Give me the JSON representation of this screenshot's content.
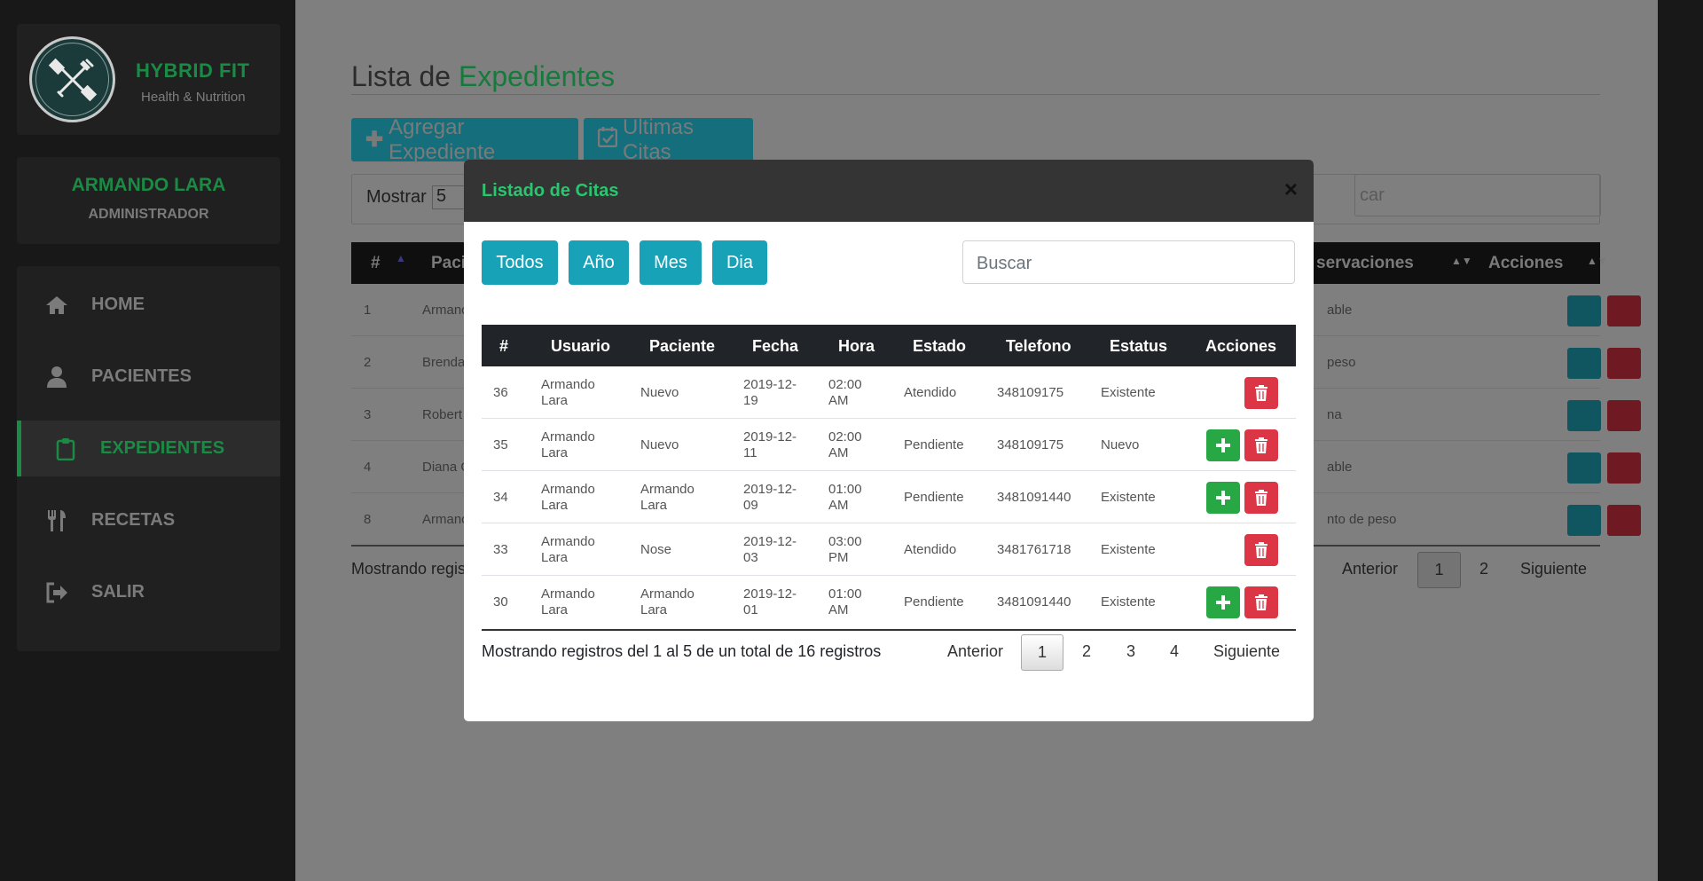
{
  "brand": {
    "name": "HYBRID FIT",
    "tagline": "Health & Nutrition",
    "logo_text": "HYBRID FIT"
  },
  "user": {
    "name": "ARMANDO LARA",
    "role": "ADMINISTRADOR"
  },
  "nav": [
    {
      "label": "HOME",
      "icon": "home-icon"
    },
    {
      "label": "PACIENTES",
      "icon": "user-icon"
    },
    {
      "label": "EXPEDIENTES",
      "icon": "clipboard-icon",
      "active": true
    },
    {
      "label": "RECETAS",
      "icon": "utensils-icon"
    },
    {
      "label": "SALIR",
      "icon": "sign-out-icon"
    }
  ],
  "page": {
    "title_prefix": "Lista de",
    "title_highlight": "Expedientes",
    "add_button": "Agregar Expediente",
    "citas_button": "Ultimas Citas",
    "show_label": "Mostrar",
    "show_value": "5",
    "search_partial": "car",
    "columns": {
      "num": "#",
      "paciente": "Paci",
      "observaciones": "servaciones",
      "acciones": "Acciones"
    },
    "rows": [
      {
        "num": "1",
        "name": "Armanc",
        "obs": "able"
      },
      {
        "num": "2",
        "name": "Brenda",
        "obs": "peso"
      },
      {
        "num": "3",
        "name": "Robert",
        "obs": "na"
      },
      {
        "num": "4",
        "name": "Diana G",
        "obs": "able"
      },
      {
        "num": "8",
        "name": "Armanc",
        "obs": "nto de peso"
      }
    ],
    "footer_partial": "Mostrando regis",
    "pager": {
      "prev": "Anterior",
      "pages": [
        "1",
        "2"
      ],
      "next": "Siguiente"
    }
  },
  "modal": {
    "title": "Listado de Citas",
    "close": "×",
    "filters": [
      "Todos",
      "Año",
      "Mes",
      "Dia"
    ],
    "search_placeholder": "Buscar",
    "columns": [
      "#",
      "Usuario",
      "Paciente",
      "Fecha",
      "Hora",
      "Estado",
      "Telefono",
      "Estatus",
      "Acciones"
    ],
    "rows": [
      {
        "num": "36",
        "usuario_l1": "Armando",
        "usuario_l2": "Lara",
        "paciente_l1": "Nuevo",
        "paciente_l2": "",
        "fecha_l1": "2019-12-",
        "fecha_l2": "19",
        "hora_l1": "02:00",
        "hora_l2": "AM",
        "estado": "Atendido",
        "telefono": "348109175",
        "estatus": "Existente",
        "can_add": false
      },
      {
        "num": "35",
        "usuario_l1": "Armando",
        "usuario_l2": "Lara",
        "paciente_l1": "Nuevo",
        "paciente_l2": "",
        "fecha_l1": "2019-12-",
        "fecha_l2": "11",
        "hora_l1": "02:00",
        "hora_l2": "AM",
        "estado": "Pendiente",
        "telefono": "348109175",
        "estatus": "Nuevo",
        "can_add": true
      },
      {
        "num": "34",
        "usuario_l1": "Armando",
        "usuario_l2": "Lara",
        "paciente_l1": "Armando",
        "paciente_l2": "Lara",
        "fecha_l1": "2019-12-",
        "fecha_l2": "09",
        "hora_l1": "01:00",
        "hora_l2": "AM",
        "estado": "Pendiente",
        "telefono": "3481091440",
        "estatus": "Existente",
        "can_add": true
      },
      {
        "num": "33",
        "usuario_l1": "Armando",
        "usuario_l2": "Lara",
        "paciente_l1": "Nose",
        "paciente_l2": "",
        "fecha_l1": "2019-12-",
        "fecha_l2": "03",
        "hora_l1": "03:00",
        "hora_l2": "PM",
        "estado": "Atendido",
        "telefono": "3481761718",
        "estatus": "Existente",
        "can_add": false
      },
      {
        "num": "30",
        "usuario_l1": "Armando",
        "usuario_l2": "Lara",
        "paciente_l1": "Armando",
        "paciente_l2": "Lara",
        "fecha_l1": "2019-12-",
        "fecha_l2": "01",
        "hora_l1": "01:00",
        "hora_l2": "AM",
        "estado": "Pendiente",
        "telefono": "3481091440",
        "estatus": "Existente",
        "can_add": true
      }
    ],
    "footer": "Mostrando registros del 1 al 5 de un total de 16 registros",
    "pager": {
      "prev": "Anterior",
      "pages": [
        "1",
        "2",
        "3",
        "4"
      ],
      "current": "1",
      "next": "Siguiente"
    }
  },
  "colors": {
    "brand_green": "#1b8a45",
    "modal_title": "#28c76f",
    "info": "#17a2b8",
    "success": "#28a745",
    "danger": "#dc3545",
    "dark": "#212529"
  }
}
